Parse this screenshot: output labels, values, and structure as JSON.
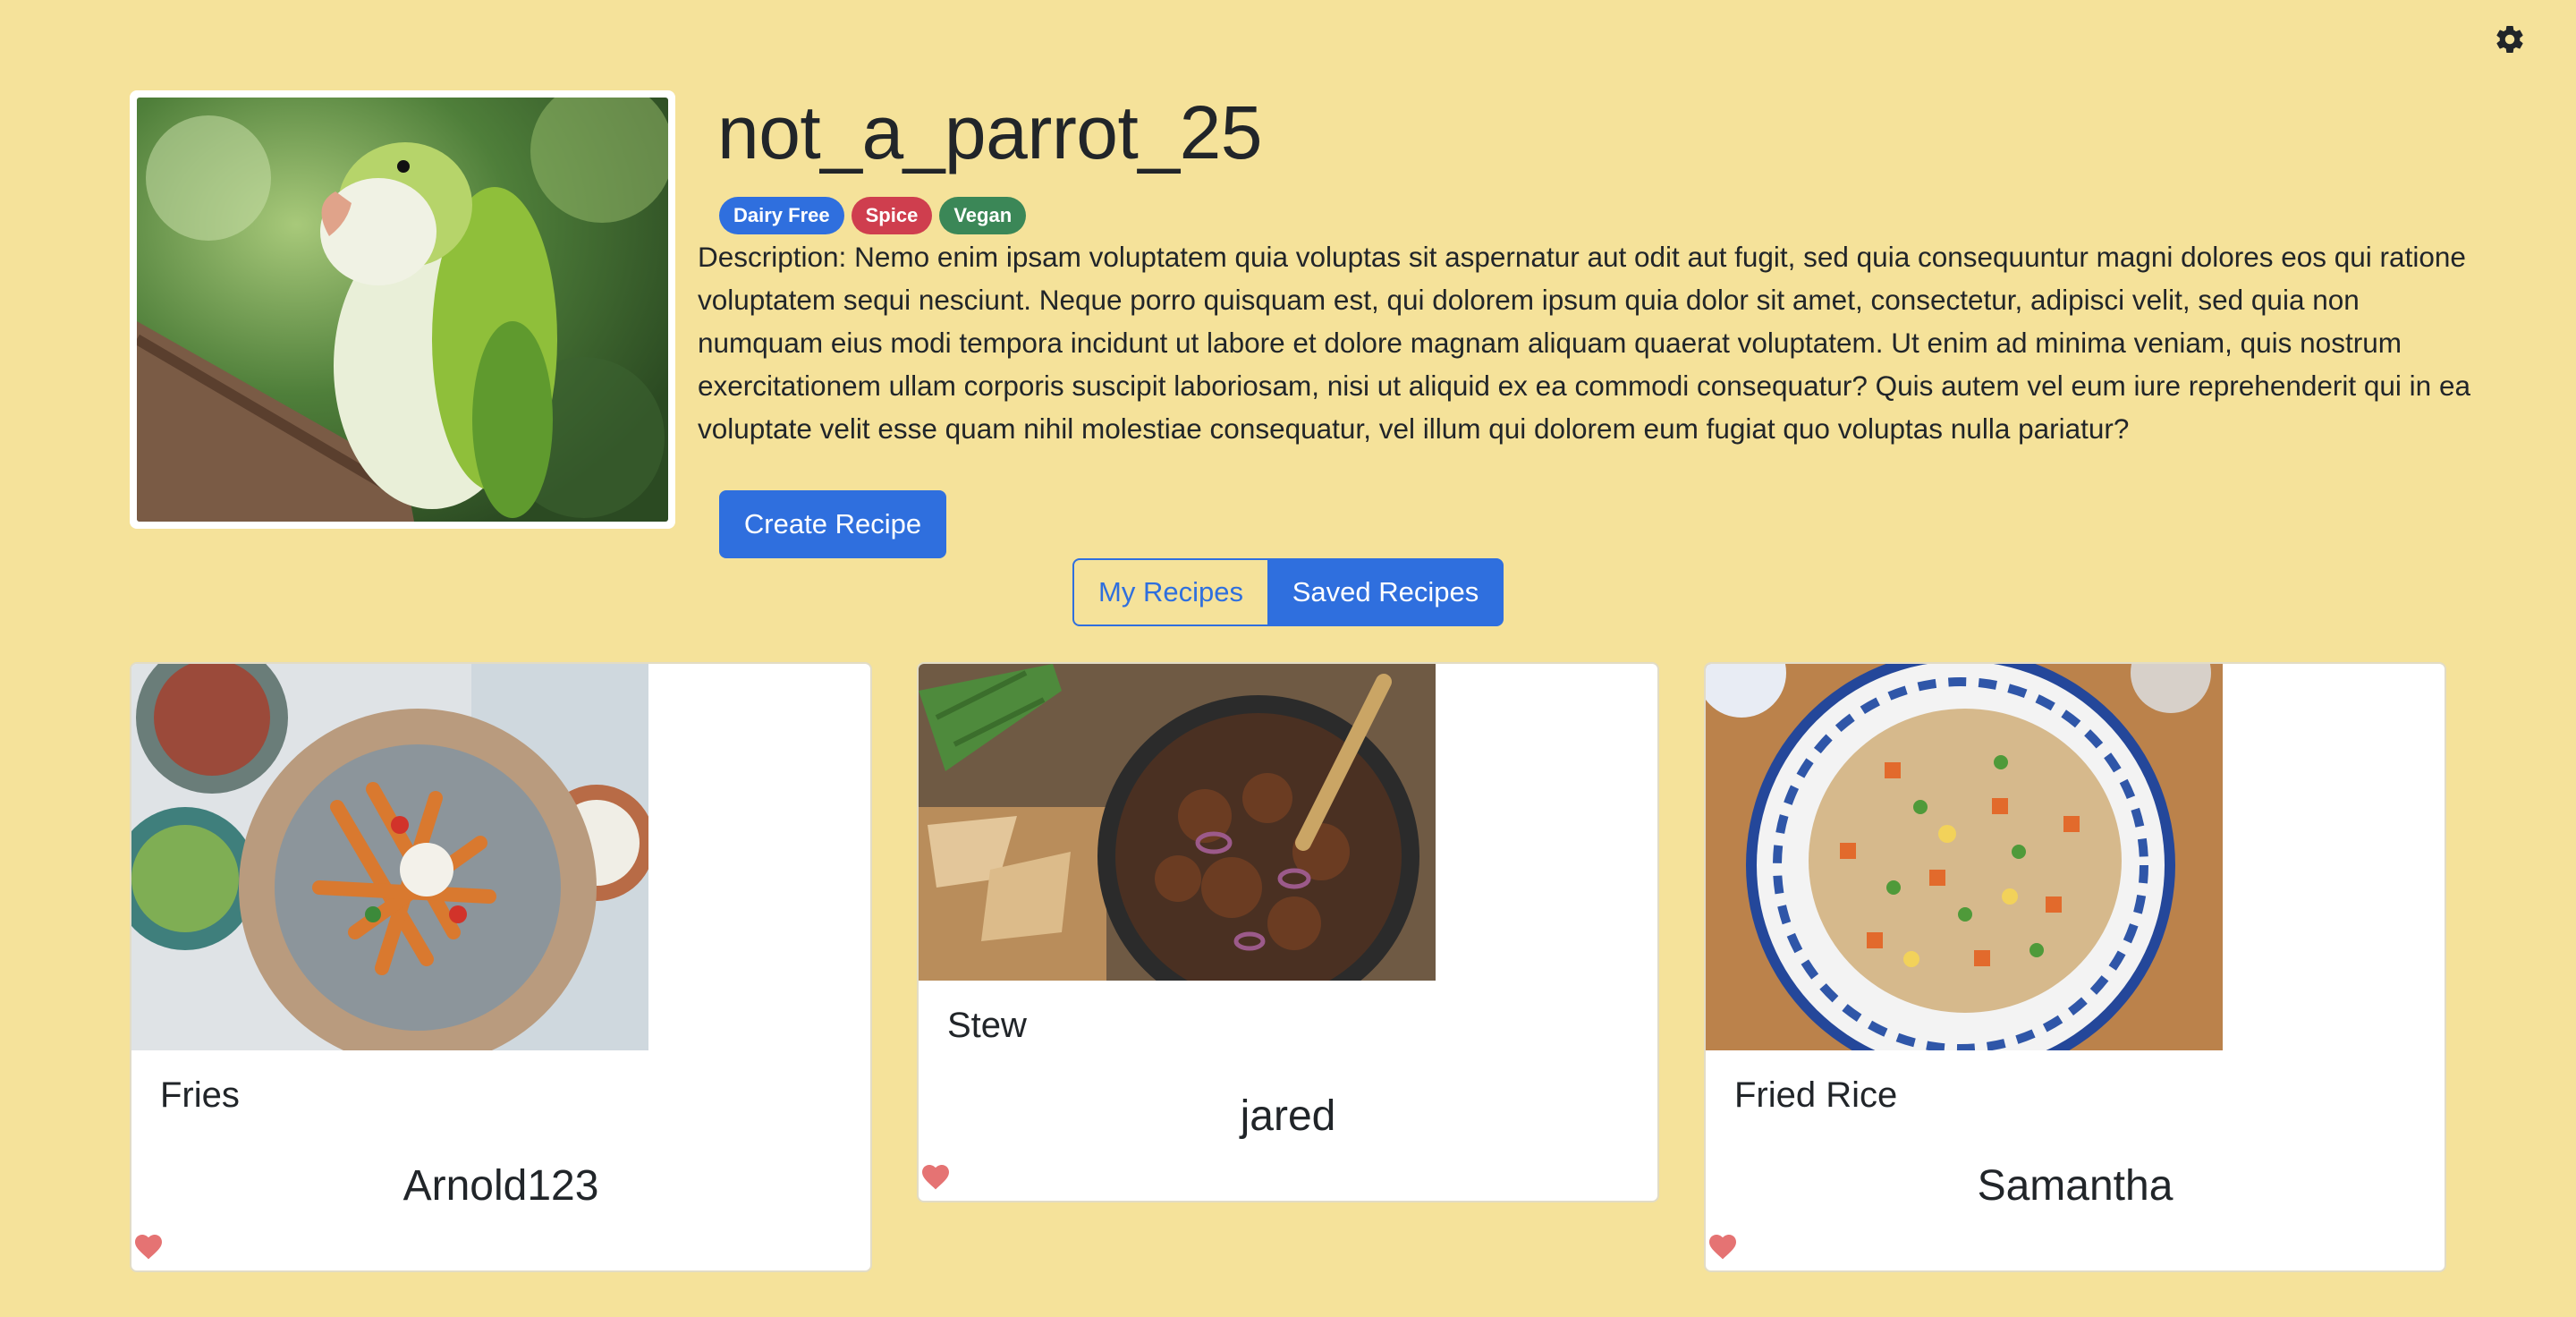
{
  "profile": {
    "username": "not_a_parrot_25",
    "badges": [
      "Dairy Free",
      "Spice",
      "Vegan"
    ],
    "description": "Description: Nemo enim ipsam voluptatem quia voluptas sit aspernatur aut odit aut fugit, sed quia consequuntur magni dolores eos qui ratione voluptatem sequi nesciunt. Neque porro quisquam est, qui dolorem ipsum quia dolor sit amet, consectetur, adipisci velit, sed quia non numquam eius modi tempora incidunt ut labore et dolore magnam aliquam quaerat voluptatem. Ut enim ad minima veniam, quis nostrum exercitationem ullam corporis suscipit laboriosam, nisi ut aliquid ex ea commodi consequatur? Quis autem vel eum iure reprehenderit qui in ea voluptate velit esse quam nihil molestiae consequatur, vel illum qui dolorem eum fugiat quo voluptas nulla pariatur?"
  },
  "actions": {
    "create_label": "Create Recipe"
  },
  "tabs": {
    "my_label": "My Recipes",
    "saved_label": "Saved Recipes",
    "active": "Saved Recipes"
  },
  "recipes": [
    {
      "title": "Fries",
      "author": "Arnold123"
    },
    {
      "title": "Stew",
      "author": "jared"
    },
    {
      "title": "Fried Rice",
      "author": "Samantha"
    }
  ],
  "colors": {
    "background": "#f5e29a",
    "primary": "#2f6fde",
    "badge_dairy_free": "#2f6fde",
    "badge_spice": "#cf3e4e",
    "badge_vegan": "#3b8757",
    "heart": "#e57373"
  },
  "icons": {
    "settings": "gear-icon",
    "like": "heart-icon"
  }
}
